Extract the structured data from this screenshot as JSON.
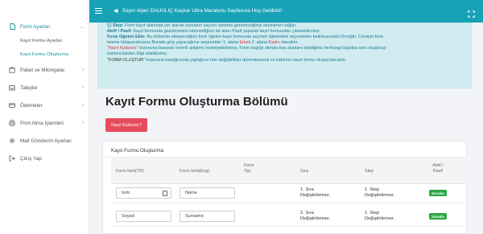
{
  "topbar": {
    "welcome": "Sayın Alper DALKILIÇ Kaçkar Ultra Maratonu Sayfasına Hoş Geldiniz!"
  },
  "sidebar": {
    "items": [
      {
        "label": "Form Ayarları",
        "icon": "file-icon"
      },
      {
        "label": "Paket ve Milongalar",
        "icon": "box-icon"
      },
      {
        "label": "Talepler",
        "icon": "inbox-icon"
      },
      {
        "label": "Ödemeler",
        "icon": "card-icon"
      },
      {
        "label": "Print Alma İşlemleri",
        "icon": "print-icon"
      },
      {
        "label": "Mail Gönderim Ayarları",
        "icon": "gear-icon"
      },
      {
        "label": "Çıkış Yap",
        "icon": "logout-icon"
      }
    ],
    "subitems": [
      "Kayıt Formu Ayarları",
      "Kayıt Formu Oluşturma"
    ]
  },
  "info": {
    "l1_b": "Step:",
    "l1": " Form kayıt alanında yer alacak soruların kaçıncı adımda görüneceğinizi seçmenizi sağlar.",
    "l2_b": "Aktif / Pasif:",
    "l2": " Kayıt formunda gözükmesini istemediğiniz bir alanı Pasif yaparak kayıt formundan çıkarabilirsiniz.",
    "l3_b": "Form Öğeleri Ekle:",
    "l3": " Bu bölümde ekleyeceğiniz form öğeleri kayıt formunda seçmeli öğelerdeki seçenekleri belirleyecektir.Örneğin: Cinsiyet form",
    "l4a": "ismine tıklayacaksanız Burada giriş yapacağınız seçenekler 1. alana ",
    "l4_red": "Erkek",
    "l4b": " 2. alana ",
    "l4_red2": "Kadın",
    "l4c": " olacaktır.",
    "l5_red": "\"Nasıl Kullanılır\"",
    "l5": " butonuna basarak resimli anlatımı inceleyebilirsiniz. Form başlığı altında boş alanlara istediğiniz herhangi başlıkta soru oluşturup",
    "l6": "katılımcılardan bilgi alabilirsiniz.",
    "l7_dark": "\"FORM OLUŞTUR\"",
    "l7": " butonuna bastığınızda yaptığınız tüm değişiklikler düzenlenecek ve katılımcı kayıt formu oluşturulacaktır."
  },
  "main": {
    "title": "Kayıt Formu Oluşturma Bölümü",
    "help_button": "Nasıl Kullanılır?"
  },
  "card": {
    "title": "Kayıt Formu Oluşturma",
    "headers": {
      "name_tr": "Form İsmi(TR)",
      "name_eng": "Form İsmi(Eng)",
      "type": "Form\nTipi",
      "order": "Sıra",
      "step": "Step",
      "status": "Aktif /\nPasif"
    },
    "rows": [
      {
        "name_tr": "İsim",
        "name_eng": "Name",
        "order": "1. Sıra\nDeğiştirilemez.",
        "step": "1. Step\nDeğiştirilemez.",
        "status": "Zorunlu"
      },
      {
        "name_tr": "Soyad",
        "name_eng": "Surname",
        "order": "2. Sıra\nDeğiştirilemez.",
        "step": "1. Step\nDeğiştirilemez.",
        "status": "Zorunlu"
      }
    ]
  },
  "colors": {
    "accent": "#17a2b8",
    "danger": "#e74c5c",
    "success": "#28a745",
    "info_bg": "#d1ecf1"
  }
}
